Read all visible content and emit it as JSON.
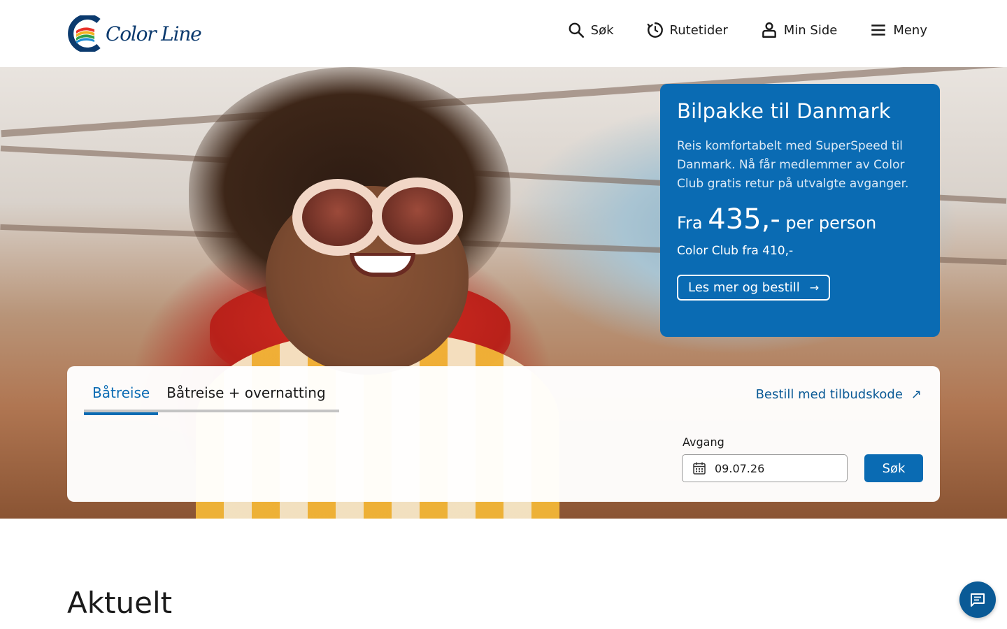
{
  "header": {
    "logo_text": "Color Line",
    "nav": [
      {
        "label": "Søk",
        "icon": "search-icon"
      },
      {
        "label": "Rutetider",
        "icon": "clock-icon"
      },
      {
        "label": "Min Side",
        "icon": "user-icon"
      },
      {
        "label": "Meny",
        "icon": "menu-icon"
      }
    ]
  },
  "promo": {
    "title": "Bilpakke til Danmark",
    "description": "Reis komfortabelt med SuperSpeed til Danmark. Nå får medlemmer av Color Club gratis retur på utvalgte avganger.",
    "price_prefix": "Fra",
    "price_value": "435,-",
    "price_suffix": "per person",
    "club_price": "Color Club fra 410,-",
    "cta_label": "Les mer og bestill",
    "cta_icon": "arrow-right-icon",
    "color": "#0a6bb3"
  },
  "booking": {
    "tabs": [
      {
        "label": "Båtreise",
        "active": true
      },
      {
        "label": "Båtreise + overnatting",
        "active": false
      }
    ],
    "offer_link": "Bestill med tilbudskode",
    "offer_icon": "external-arrow-icon",
    "departure_label": "Avgang",
    "departure_value": "09.07.26",
    "search_label": "Søk"
  },
  "main": {
    "section_title": "Aktuelt"
  },
  "chat": {
    "icon": "chat-icon"
  }
}
